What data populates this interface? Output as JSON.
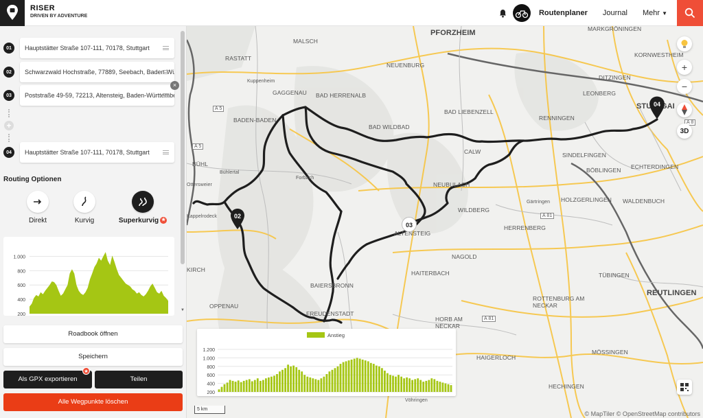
{
  "app": {
    "brand": "RISER",
    "tagline": "DRIVEN BY ADVENTURE"
  },
  "nav": {
    "routeplanner": "Routenplaner",
    "journal": "Journal",
    "more": "Mehr"
  },
  "waypoints": [
    {
      "num": "01",
      "address": "Hauptstätter Straße 107-111, 70178, Stuttgart"
    },
    {
      "num": "02",
      "address": "Schwarzwald Hochstraße, 77889, Seebach, Baden-Württemberg"
    },
    {
      "num": "03",
      "address": "Poststraße 49-59, 72213, Altensteig, Baden-Württemberg"
    },
    {
      "num": "04",
      "address": "Hauptstätter Straße 107-111, 70178, Stuttgart"
    }
  ],
  "routing": {
    "title": "Routing Optionen",
    "options": [
      {
        "label": "Direkt",
        "icon": "arrow-right-icon",
        "selected": false
      },
      {
        "label": "Kurvig",
        "icon": "curvy-road-icon",
        "selected": false
      },
      {
        "label": "Superkurvig",
        "icon": "super-curvy-road-icon",
        "selected": true
      }
    ]
  },
  "buttons": {
    "roadbook": "Roadbook öffnen",
    "save": "Speichern",
    "gpx": "Als GPX exportieren",
    "share": "Teilen",
    "delete_all": "Alle Wegpunkte löschen"
  },
  "chart_data": [
    {
      "type": "area",
      "yticks": [
        "1.000",
        "800",
        "600",
        "400",
        "200"
      ],
      "ylim": [
        200,
        1100
      ],
      "color": "#a5c614",
      "values": [
        300,
        340,
        420,
        460,
        440,
        500,
        470,
        520,
        560,
        600,
        650,
        640,
        600,
        520,
        450,
        480,
        540,
        600,
        760,
        820,
        760,
        600,
        520,
        480,
        460,
        500,
        560,
        680,
        760,
        850,
        900,
        980,
        940,
        1000,
        1060,
        940,
        880,
        1010,
        920,
        820,
        740,
        700,
        660,
        620,
        600,
        580,
        540,
        520,
        480,
        500,
        460,
        440,
        470,
        520,
        580,
        620,
        560,
        500,
        480,
        520,
        450,
        420,
        380
      ]
    },
    {
      "type": "bar",
      "legend": "Anstieg",
      "yticks": [
        "1.200",
        "1.000",
        "800",
        "600",
        "400",
        "200"
      ],
      "ylim": [
        200,
        1200
      ],
      "color": "#a5c614",
      "values": [
        260,
        320,
        380,
        420,
        480,
        460,
        440,
        470,
        430,
        460,
        480,
        500,
        450,
        480,
        520,
        460,
        480,
        520,
        540,
        560,
        580,
        620,
        680,
        720,
        760,
        840,
        800,
        820,
        780,
        720,
        680,
        600,
        560,
        540,
        520,
        500,
        480,
        520,
        560,
        620,
        680,
        720,
        760,
        800,
        860,
        900,
        920,
        940,
        960,
        980,
        1000,
        980,
        960,
        940,
        920,
        880,
        860,
        820,
        800,
        760,
        700,
        640,
        600,
        580,
        560,
        600,
        560,
        520,
        540,
        520,
        480,
        500,
        520,
        480,
        440,
        460,
        480,
        520,
        500,
        460,
        440,
        420,
        400,
        380,
        360
      ]
    }
  ],
  "map": {
    "labels": {
      "pforzheim": "PFORZHEIM",
      "malsch": "MALSCH",
      "rastatt": "RASTATT",
      "neuenburg": "NEUENBURG",
      "kuppenheim": "Kuppenheim",
      "gaggenau": "GAGGENAU",
      "bad_herrenalb": "BAD HERRENALB",
      "baden_baden": "BADEN-BADEN",
      "bad_wildbad": "BAD WILDBAD",
      "bad_liebenzell": "BAD LIEBENZELL",
      "calw": "CALW",
      "neubulach": "NEUBULACH",
      "wildberg": "WILDBERG",
      "buehl": "BÜHL",
      "buehlertal": "Bühlertal",
      "ottersweier": "Ottersweier",
      "forbach": "Forbach",
      "kappelrodeck": "Kappelrodeck",
      "altensteig": "ALTENSTEIG",
      "nagold": "NAGOLD",
      "haiterbach": "HAITERBACH",
      "baiersbronn": "BAIERSBRONN",
      "freudenstadt": "FREUDENSTADT",
      "oppenau": "OPPENAU",
      "kirch": "KIRCH",
      "horb": "HORB AM NECKAR",
      "haigerloch": "HAIGERLOCH",
      "hechingen": "HECHINGEN",
      "voehringen": "Vöhringen",
      "rottenburg": "ROTTENBURG AM NECKAR",
      "tuebingen": "TÜBINGEN",
      "reutlingen": "REUTLINGEN",
      "moessingen": "MÖSSINGEN",
      "herrenberg": "HERRENBERG",
      "gaertringen": "Gärtringen",
      "holzgerlingen": "HOLZGERLINGEN",
      "waldenbuch": "WALDENBUCH",
      "boeblingen": "BÖBLINGEN",
      "sindelfingen": "SINDELFINGEN",
      "echterdingen": "ECHTERDINGEN",
      "renningen": "RENNINGEN",
      "leonberg": "LEONBERG",
      "ditzingen": "DITZINGEN",
      "kornwestheim": "KORNWESTHEIM",
      "stuttgart": "STUTTGART",
      "markgroningen": "MARKGRÖNINGEN",
      "a5": "A 5",
      "a8": "A 8",
      "a81": "A 81"
    },
    "markers": [
      "02",
      "03",
      "04"
    ],
    "scale": "5 km",
    "controls": {
      "plus": "+",
      "minus": "−",
      "three_d": "3D"
    },
    "attribution": "© MapTiler © OpenStreetMap contributors"
  }
}
